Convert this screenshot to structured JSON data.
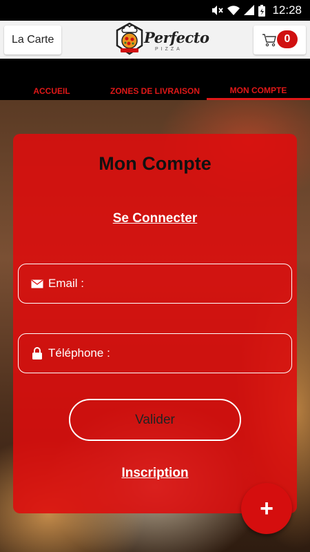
{
  "status_bar": {
    "time": "12:28"
  },
  "header": {
    "menu_label": "La Carte",
    "brand": "Perfecto",
    "brand_sub": "PIZZA",
    "cart_count": "0"
  },
  "tabs": [
    {
      "label": "ACCUEIL",
      "active": false
    },
    {
      "label": "ZONES DE LIVRAISON",
      "active": false
    },
    {
      "label": "MON COMPTE",
      "active": true
    }
  ],
  "account": {
    "title": "Mon Compte",
    "login_link": "Se Connecter",
    "email_label": "Email :",
    "phone_label": "Téléphone :",
    "submit_label": "Valider",
    "signup_link": "Inscription"
  },
  "fab": {
    "label": "+"
  },
  "colors": {
    "accent": "#e01818",
    "card": "#de0c0c",
    "header_bg": "#f2f2f2"
  },
  "icons": [
    "mute-icon",
    "wifi-icon",
    "signal-icon",
    "battery-icon",
    "cart-icon",
    "mail-icon",
    "lock-icon",
    "plus-icon"
  ]
}
